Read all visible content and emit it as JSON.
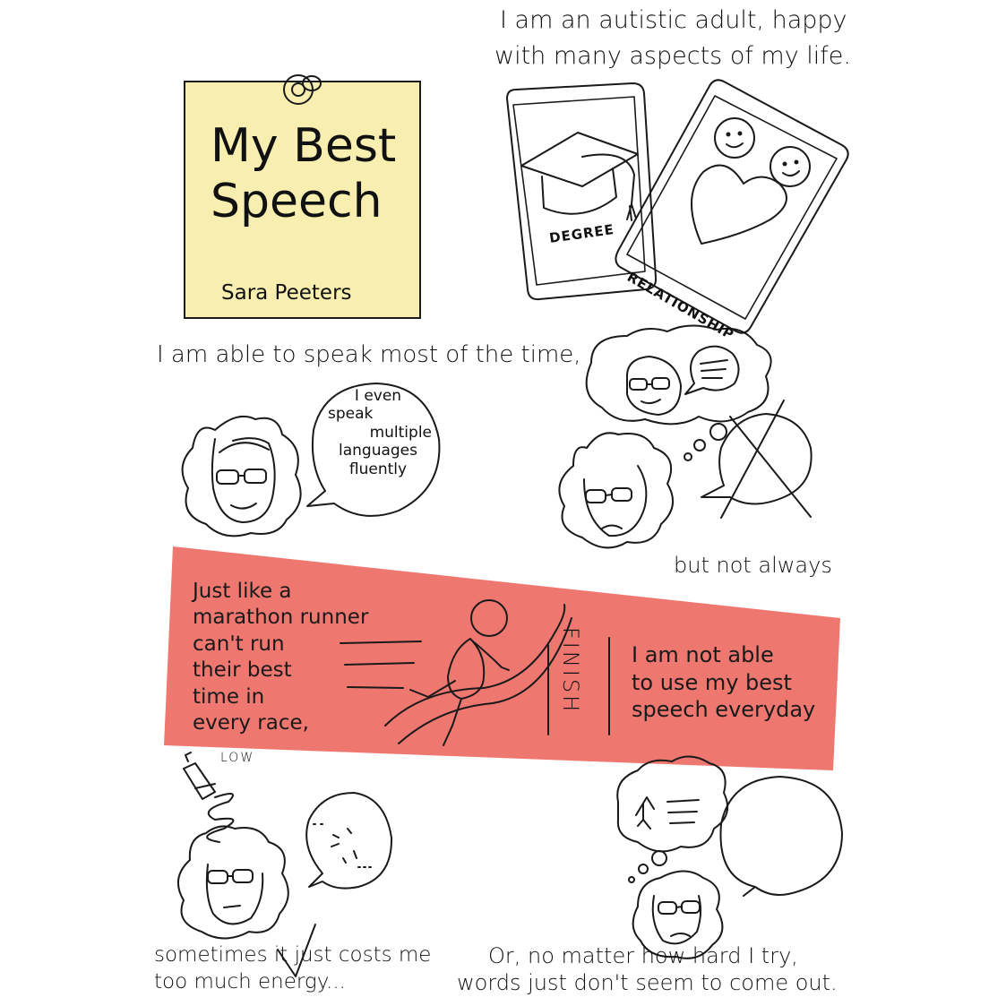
{
  "note": {
    "title_line1": "My Best",
    "title_line2": "Speech",
    "author": "Sara Peeters"
  },
  "intro": {
    "line1": "I am an autistic adult, happy",
    "line2": "with many aspects of my life."
  },
  "cards": {
    "degree_label": "DEGREE",
    "relationship_label": "RELATIONSHIP"
  },
  "speak": {
    "text": "I am able to speak most of the time,",
    "bubble": [
      "I even",
      "speak",
      "multiple",
      "languages",
      "fluently"
    ],
    "not_always": "but not always"
  },
  "band": {
    "left": [
      "Just like a",
      "marathon runner",
      "can't run",
      "their best",
      "time in",
      "every race,"
    ],
    "finish": "FINISH",
    "right": [
      "I am not able",
      "to use my best",
      "speech everyday"
    ]
  },
  "battery": {
    "label": "LOW"
  },
  "bottom_left": {
    "line1": "sometimes it just costs me",
    "line2": "too much energy..."
  },
  "bottom_right": {
    "line1": "Or, no matter how hard I try,",
    "line2": "words just don't seem to come out."
  },
  "colors": {
    "note_bg": "#f7eeb0",
    "band": "#ee7770",
    "ink": "#1a1a1a"
  }
}
